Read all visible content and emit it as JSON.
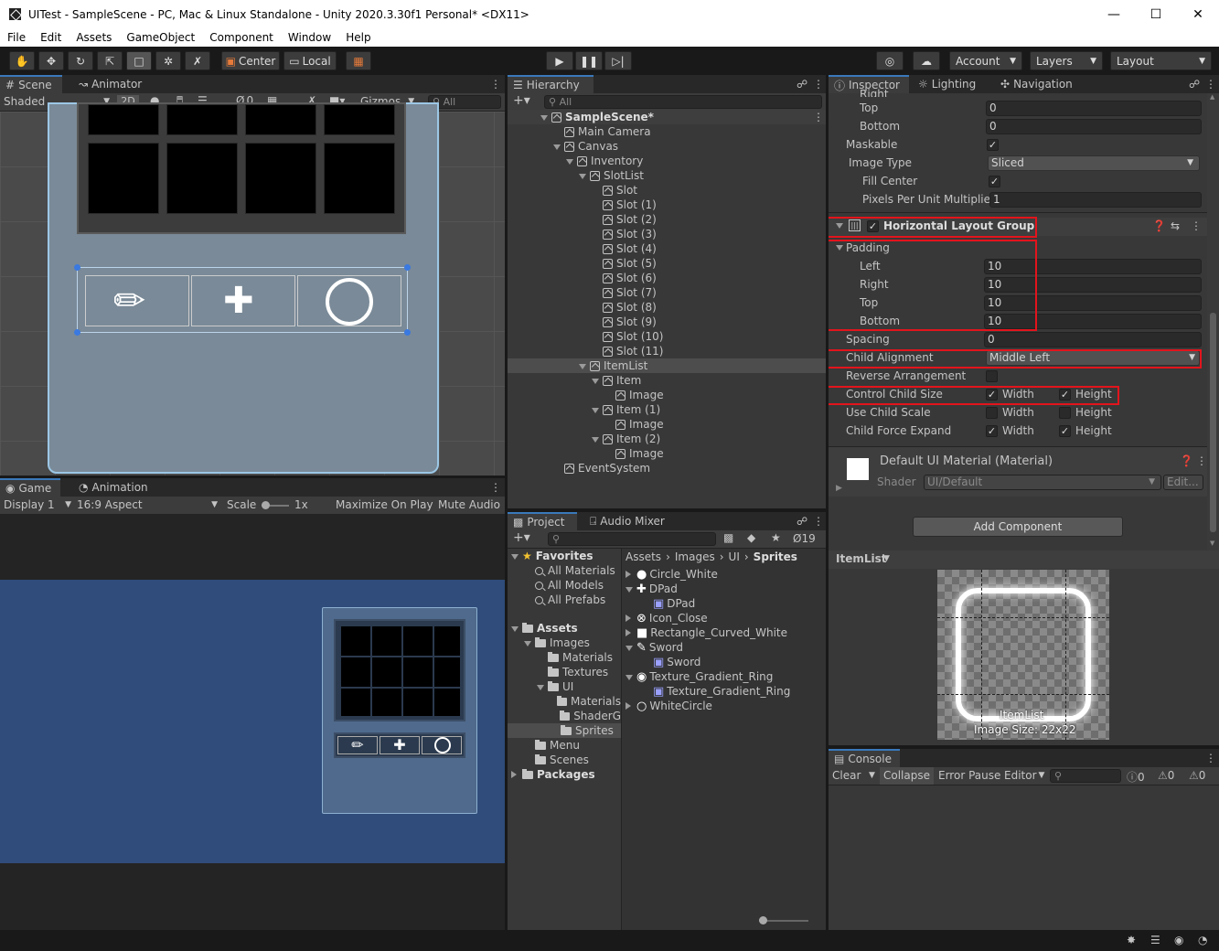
{
  "window": {
    "title": "UITest - SampleScene - PC, Mac & Linux Standalone - Unity 2020.3.30f1 Personal* <DX11>"
  },
  "menu": [
    "File",
    "Edit",
    "Assets",
    "GameObject",
    "Component",
    "Window",
    "Help"
  ],
  "toolbar": {
    "center_label": "Center",
    "local_label": "Local",
    "account_label": "Account",
    "layers_label": "Layers",
    "layout_label": "Layout"
  },
  "scene": {
    "tabs": [
      "Scene",
      "Animator"
    ],
    "shading": "Shaded",
    "mode_2d": "2D",
    "hidden_count": "0",
    "gizmos_label": "Gizmos",
    "search_placeholder": "All"
  },
  "game": {
    "tabs": [
      "Game",
      "Animation"
    ],
    "display": "Display 1",
    "aspect": "16:9 Aspect",
    "scale_label": "Scale",
    "scale_value": "1x",
    "maximize_label": "Maximize On Play",
    "mute_label": "Mute Audio"
  },
  "hierarchy": {
    "tab": "Hierarchy",
    "search_placeholder": "All",
    "rows": [
      {
        "label": "SampleScene*",
        "depth": 0,
        "kind": "scene",
        "arrow": "down"
      },
      {
        "label": "Main Camera",
        "depth": 1,
        "kind": "obj",
        "arrow": ""
      },
      {
        "label": "Canvas",
        "depth": 1,
        "kind": "obj",
        "arrow": "down"
      },
      {
        "label": "Inventory",
        "depth": 2,
        "kind": "obj",
        "arrow": "down"
      },
      {
        "label": "SlotList",
        "depth": 3,
        "kind": "obj",
        "arrow": "down"
      },
      {
        "label": "Slot",
        "depth": 4,
        "kind": "obj",
        "arrow": ""
      },
      {
        "label": "Slot (1)",
        "depth": 4,
        "kind": "obj",
        "arrow": ""
      },
      {
        "label": "Slot (2)",
        "depth": 4,
        "kind": "obj",
        "arrow": ""
      },
      {
        "label": "Slot (3)",
        "depth": 4,
        "kind": "obj",
        "arrow": ""
      },
      {
        "label": "Slot (4)",
        "depth": 4,
        "kind": "obj",
        "arrow": ""
      },
      {
        "label": "Slot (5)",
        "depth": 4,
        "kind": "obj",
        "arrow": ""
      },
      {
        "label": "Slot (6)",
        "depth": 4,
        "kind": "obj",
        "arrow": ""
      },
      {
        "label": "Slot (7)",
        "depth": 4,
        "kind": "obj",
        "arrow": ""
      },
      {
        "label": "Slot (8)",
        "depth": 4,
        "kind": "obj",
        "arrow": ""
      },
      {
        "label": "Slot (9)",
        "depth": 4,
        "kind": "obj",
        "arrow": ""
      },
      {
        "label": "Slot (10)",
        "depth": 4,
        "kind": "obj",
        "arrow": ""
      },
      {
        "label": "Slot (11)",
        "depth": 4,
        "kind": "obj",
        "arrow": ""
      },
      {
        "label": "ItemList",
        "depth": 3,
        "kind": "obj",
        "arrow": "down",
        "selected": true
      },
      {
        "label": "Item",
        "depth": 4,
        "kind": "obj",
        "arrow": "down"
      },
      {
        "label": "Image",
        "depth": 5,
        "kind": "obj",
        "arrow": ""
      },
      {
        "label": "Item (1)",
        "depth": 4,
        "kind": "obj",
        "arrow": "down"
      },
      {
        "label": "Image",
        "depth": 5,
        "kind": "obj",
        "arrow": ""
      },
      {
        "label": "Item (2)",
        "depth": 4,
        "kind": "obj",
        "arrow": "down"
      },
      {
        "label": "Image",
        "depth": 5,
        "kind": "obj",
        "arrow": ""
      },
      {
        "label": "EventSystem",
        "depth": 1,
        "kind": "obj",
        "arrow": ""
      }
    ]
  },
  "project": {
    "tabs": [
      "Project",
      "Audio Mixer"
    ],
    "hidden_count": "19",
    "tree": [
      {
        "label": "Favorites",
        "depth": 0,
        "kind": "star",
        "arrow": "down",
        "bold": true
      },
      {
        "label": "All Materials",
        "depth": 1,
        "kind": "search",
        "arrow": ""
      },
      {
        "label": "All Models",
        "depth": 1,
        "kind": "search",
        "arrow": ""
      },
      {
        "label": "All Prefabs",
        "depth": 1,
        "kind": "search",
        "arrow": ""
      },
      {
        "label": "",
        "depth": 0,
        "kind": "gap",
        "arrow": ""
      },
      {
        "label": "Assets",
        "depth": 0,
        "kind": "folder",
        "arrow": "down",
        "bold": true
      },
      {
        "label": "Images",
        "depth": 1,
        "kind": "folder",
        "arrow": "down"
      },
      {
        "label": "Materials",
        "depth": 2,
        "kind": "folder",
        "arrow": ""
      },
      {
        "label": "Textures",
        "depth": 2,
        "kind": "folder",
        "arrow": ""
      },
      {
        "label": "UI",
        "depth": 2,
        "kind": "folder",
        "arrow": "down"
      },
      {
        "label": "Materials",
        "depth": 3,
        "kind": "folder",
        "arrow": ""
      },
      {
        "label": "ShaderG",
        "depth": 3,
        "kind": "folder",
        "arrow": ""
      },
      {
        "label": "Sprites",
        "depth": 3,
        "kind": "folder",
        "arrow": "",
        "selected": true
      },
      {
        "label": "Menu",
        "depth": 1,
        "kind": "folder",
        "arrow": ""
      },
      {
        "label": "Scenes",
        "depth": 1,
        "kind": "folder",
        "arrow": ""
      },
      {
        "label": "Packages",
        "depth": 0,
        "kind": "folder",
        "arrow": "right",
        "bold": true
      }
    ],
    "breadcrumb": [
      "Assets",
      "Images",
      "UI",
      "Sprites"
    ],
    "files": [
      {
        "label": "Circle_White",
        "kind": "circle-filled",
        "arrow": "right",
        "indent": 0
      },
      {
        "label": "DPad",
        "kind": "dpad",
        "arrow": "down",
        "indent": 0
      },
      {
        "label": "DPad",
        "kind": "sprite",
        "arrow": "",
        "indent": 1
      },
      {
        "label": "Icon_Close",
        "kind": "close",
        "arrow": "right",
        "indent": 0
      },
      {
        "label": "Rectangle_Curved_White",
        "kind": "rect-white",
        "arrow": "right",
        "indent": 0
      },
      {
        "label": "Sword",
        "kind": "sword",
        "arrow": "down",
        "indent": 0
      },
      {
        "label": "Sword",
        "kind": "sprite",
        "arrow": "",
        "indent": 1
      },
      {
        "label": "Texture_Gradient_Ring",
        "kind": "ring",
        "arrow": "down",
        "indent": 0
      },
      {
        "label": "Texture_Gradient_Ring",
        "kind": "sprite",
        "arrow": "",
        "indent": 1
      },
      {
        "label": "WhiteCircle",
        "kind": "circle-outline",
        "arrow": "right",
        "indent": 0
      }
    ]
  },
  "inspector": {
    "tabs": [
      "Inspector",
      "Lighting",
      "Navigation"
    ],
    "cut_label": "Right",
    "top_rows": [
      {
        "label": "Top",
        "value": "0"
      },
      {
        "label": "Bottom",
        "value": "0"
      }
    ],
    "maskable_label": "Maskable",
    "image_type_label": "Image Type",
    "image_type_value": "Sliced",
    "fill_center_label": "Fill Center",
    "ppu_label": "Pixels Per Unit Multiplier",
    "ppu_value": "1",
    "component_title": "Horizontal Layout Group",
    "padding_label": "Padding",
    "padding": [
      {
        "label": "Left",
        "value": "10"
      },
      {
        "label": "Right",
        "value": "10"
      },
      {
        "label": "Top",
        "value": "10"
      },
      {
        "label": "Bottom",
        "value": "10"
      }
    ],
    "spacing_label": "Spacing",
    "spacing_value": "0",
    "child_alignment_label": "Child Alignment",
    "child_alignment_value": "Middle Left",
    "reverse_label": "Reverse Arrangement",
    "control_child_size_label": "Control Child Size",
    "use_child_scale_label": "Use Child Scale",
    "child_force_expand_label": "Child Force Expand",
    "width_label": "Width",
    "height_label": "Height",
    "material_title": "Default UI Material (Material)",
    "shader_label": "Shader",
    "shader_value": "UI/Default",
    "edit_label": "Edit...",
    "add_component_label": "Add Component",
    "preview_title": "ItemList",
    "preview_name": "ItemList",
    "preview_size": "Image Size: 22x22"
  },
  "console": {
    "tab": "Console",
    "clear_label": "Clear",
    "collapse_label": "Collapse",
    "error_pause_label": "Error Pause",
    "editor_label": "Editor",
    "info_count": "0",
    "warn_count": "0",
    "error_count": "0"
  }
}
